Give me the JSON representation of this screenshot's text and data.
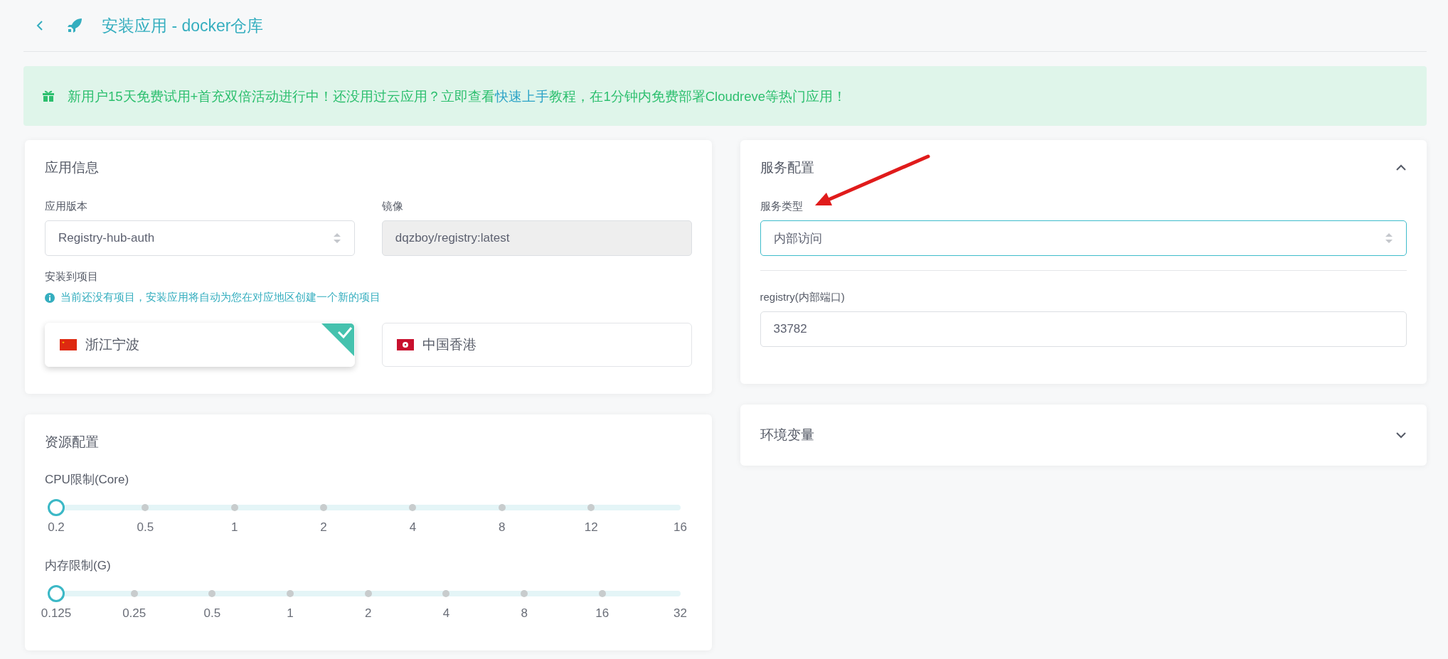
{
  "header": {
    "title": "安装应用 - docker仓库"
  },
  "banner": {
    "text_before": "新用户15天免费试用+首充双倍活动进行中！还没用过云应用？立即查看",
    "link": "快速上手",
    "text_after": "教程，在1分钟内免费部署Cloudreve等热门应用！"
  },
  "app_info": {
    "title": "应用信息",
    "version_label": "应用版本",
    "version_value": "Registry-hub-auth",
    "image_label": "镜像",
    "image_value": "dqzboy/registry:latest",
    "project_label": "安装到项目",
    "project_hint": "当前还没有项目，安装应用将自动为您在对应地区创建一个新的项目",
    "regions": [
      {
        "name": "浙江宁波",
        "kind": "cn",
        "selected": true
      },
      {
        "name": "中国香港",
        "kind": "hk",
        "selected": false
      }
    ]
  },
  "resources": {
    "title": "资源配置",
    "sliders": [
      {
        "label": "CPU限制(Core)",
        "level": 0,
        "ticks": [
          "0.2",
          "0.5",
          "1",
          "2",
          "4",
          "8",
          "12",
          "16"
        ]
      },
      {
        "label": "内存限制(G)",
        "level": 0,
        "ticks": [
          "0.125",
          "0.25",
          "0.5",
          "1",
          "2",
          "4",
          "8",
          "16",
          "32"
        ]
      }
    ]
  },
  "service": {
    "title": "服务配置",
    "expanded": true,
    "type_label": "服务类型",
    "type_value": "内部访问",
    "port_label": "registry(内部端口)",
    "port_value": "33782"
  },
  "env": {
    "title": "环境变量",
    "expanded": false
  }
}
